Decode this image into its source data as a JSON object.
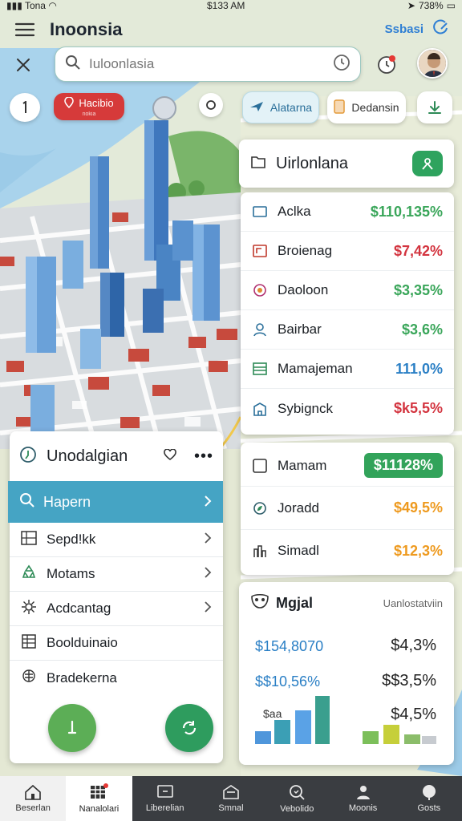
{
  "status_bar": {
    "carrier": "Tona",
    "time": "$133 AM",
    "battery": "738%"
  },
  "header": {
    "title": "Inoonsia",
    "link": "Ssbasi",
    "menu_icon": "menu-icon",
    "edit_icon": "edit-icon"
  },
  "search": {
    "placeholder": "Iuloonlasia",
    "value": ""
  },
  "chips": {
    "red_title": "Hacibio",
    "red_sub": "nokia",
    "blue": "Alatarna",
    "orange": "Dedansin"
  },
  "right_panel": {
    "title": "Uirlonlana",
    "rows": [
      {
        "label": "Aclka",
        "value": "$110,135%",
        "color": "green",
        "icon": "folder-icon"
      },
      {
        "label": "Broienag",
        "value": "$7,42%",
        "color": "red",
        "icon": "document-icon"
      },
      {
        "label": "Daoloon",
        "value": "$3,35%",
        "color": "green",
        "icon": "target-icon"
      },
      {
        "label": "Bairbar",
        "value": "$3,6%",
        "color": "green",
        "icon": "person-icon"
      },
      {
        "label": "Mamajeman",
        "value": "111,0%",
        "color": "blue",
        "icon": "list-icon"
      },
      {
        "label": "Sybignck",
        "value": "$k5,5%",
        "color": "red",
        "icon": "building-icon"
      }
    ]
  },
  "right_panel_2": {
    "rows": [
      {
        "label": "Mamam",
        "value": "$11128%",
        "color": "pill",
        "icon": "checkbox-icon"
      },
      {
        "label": "Joradd",
        "value": "$49,5%",
        "color": "orange",
        "icon": "leaf-icon"
      },
      {
        "label": "Simadl",
        "value": "$12,3%",
        "color": "orange",
        "icon": "chart-icon"
      }
    ]
  },
  "left_panel": {
    "title": "Unodalgian",
    "selected": "Hapern",
    "items": [
      {
        "label": "Sepd!kk",
        "icon": "grid-icon"
      },
      {
        "label": "Motams",
        "icon": "recycle-icon"
      },
      {
        "label": "Acdcantag",
        "icon": "gear-icon"
      },
      {
        "label": "Boolduinaio",
        "icon": "table-icon"
      },
      {
        "label": "Bradekerna",
        "icon": "brain-icon"
      }
    ]
  },
  "chart_card": {
    "title": "Mgjal",
    "subtitle": "Uanlostatviin",
    "left_values": [
      "$154,8070",
      "$$10,56%",
      "$aa"
    ],
    "right_values": [
      "$4,3%",
      "$$3,5%",
      "$4,5%"
    ]
  },
  "tabs": [
    {
      "label": "Beserlan",
      "icon": "home-icon"
    },
    {
      "label": "Nanalolari",
      "icon": "grid-icon"
    },
    {
      "label": "Liberelian",
      "icon": "screen-icon"
    },
    {
      "label": "Smnal",
      "icon": "house-icon"
    },
    {
      "label": "Vebolido",
      "icon": "search-icon"
    },
    {
      "label": "Moonis",
      "icon": "person-icon"
    },
    {
      "label": "Gosts",
      "icon": "circle-icon"
    }
  ],
  "colors": {
    "accent_blue": "#45a4c4",
    "accent_green": "#32a35a",
    "chip_red": "#d63a3a"
  }
}
